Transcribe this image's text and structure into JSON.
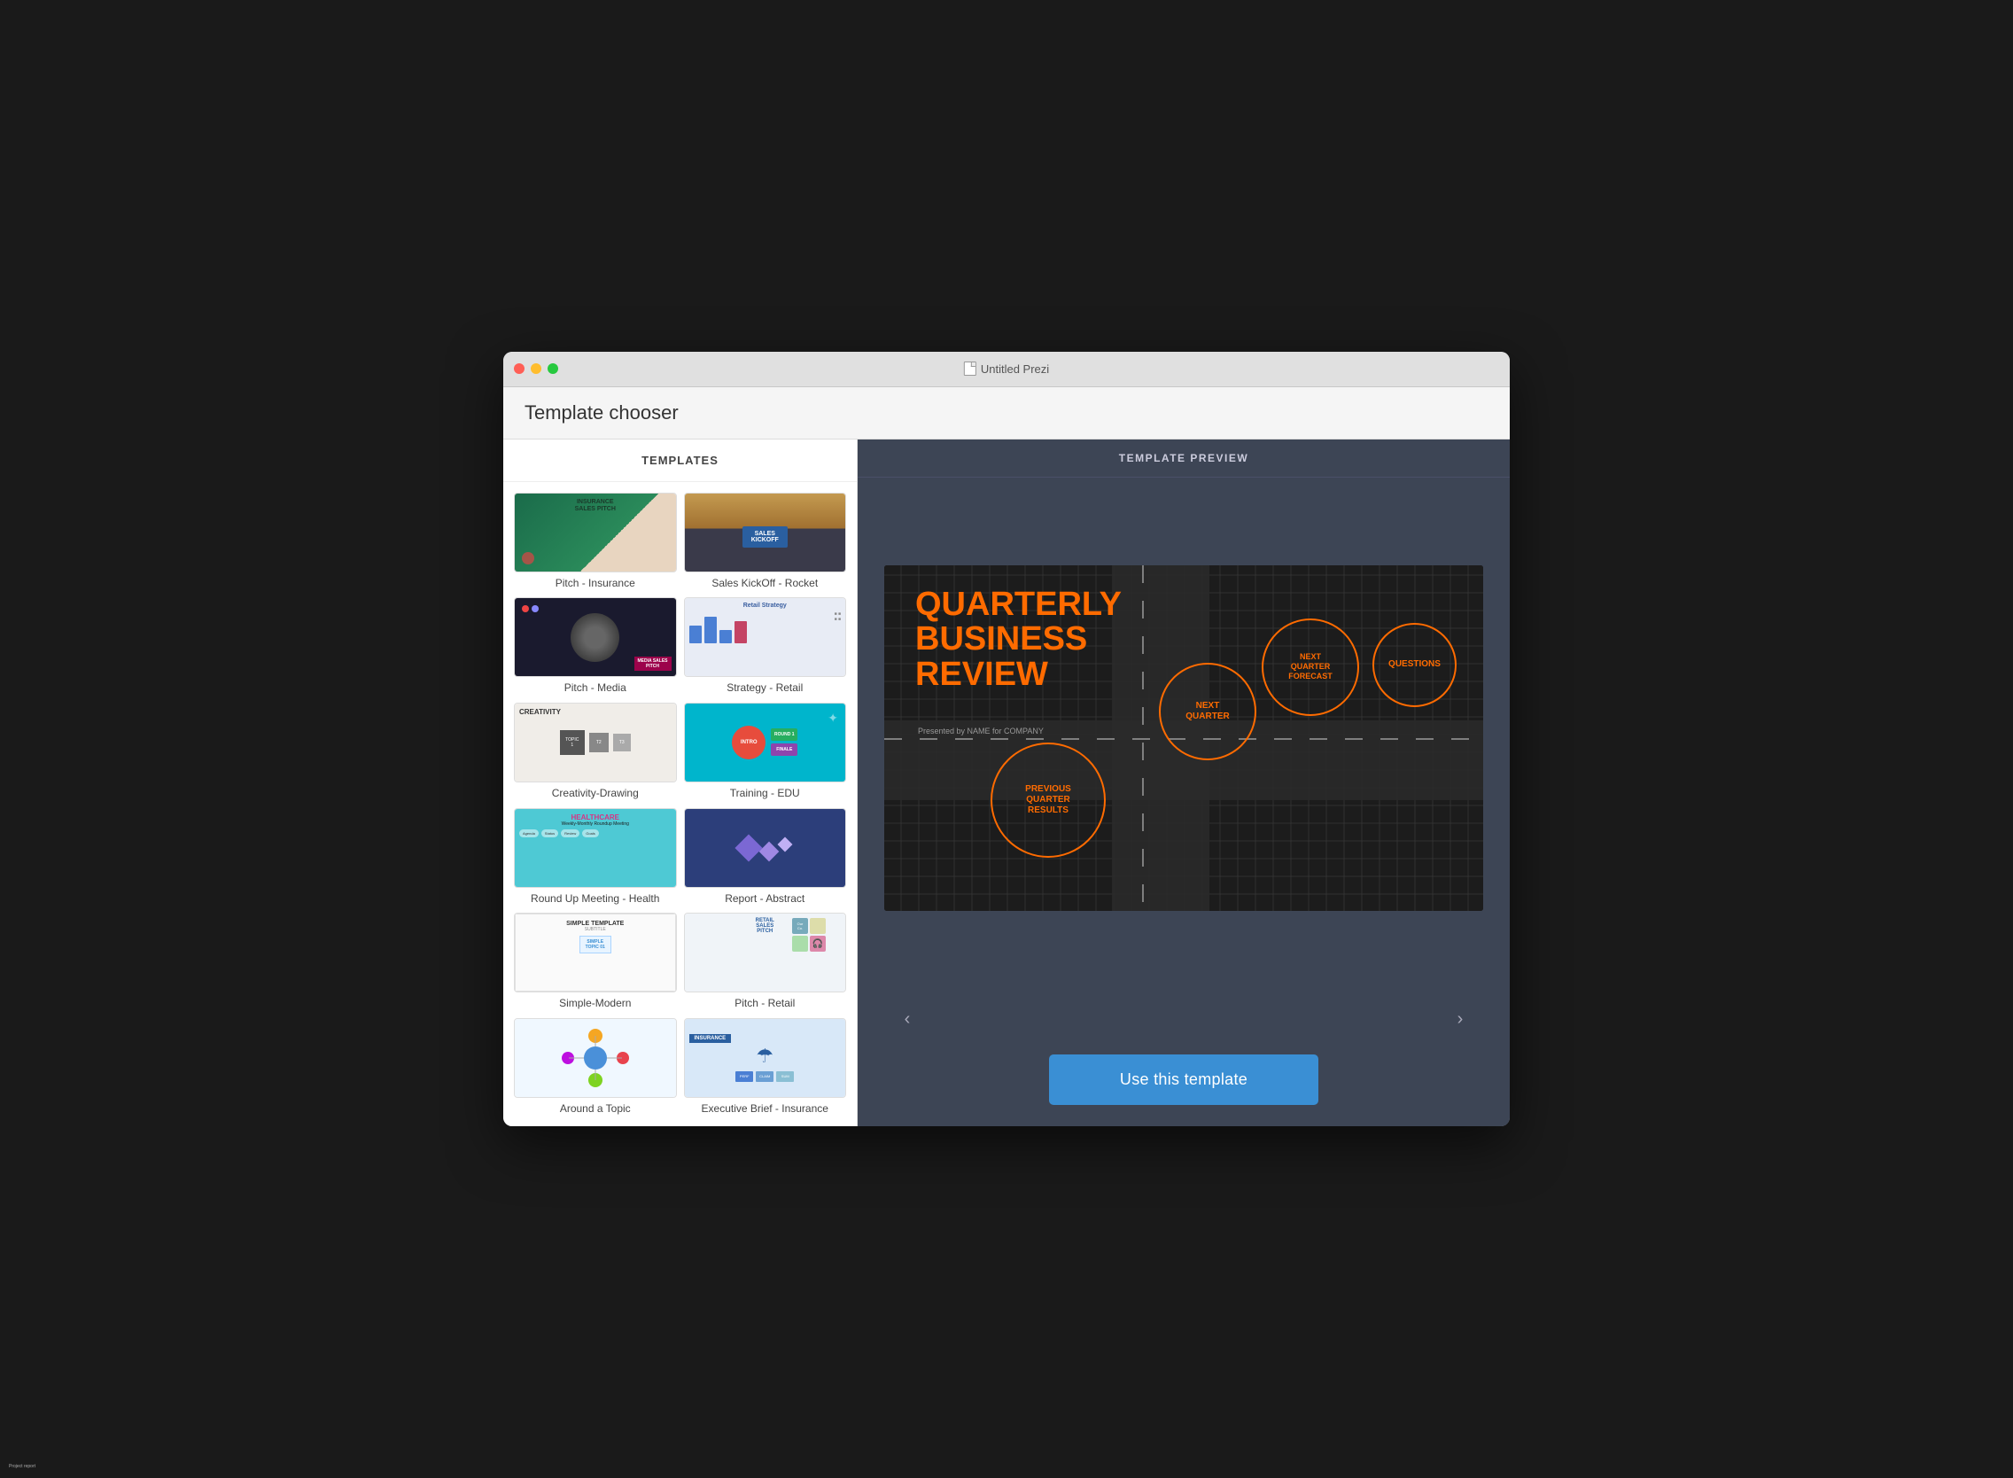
{
  "window": {
    "title": "Untitled Prezi"
  },
  "app": {
    "header_title": "Template chooser"
  },
  "templates_panel": {
    "header": "TEMPLATES"
  },
  "preview_panel": {
    "header": "TEMPLATE PREVIEW",
    "use_button_label": "Use this template"
  },
  "templates": [
    {
      "id": "pitch-insurance",
      "label": "Pitch - Insurance",
      "type": "thumb-insurance"
    },
    {
      "id": "sales-kickoff",
      "label": "Sales KickOff - Rocket",
      "type": "thumb-sales-kickoff"
    },
    {
      "id": "pitch-media",
      "label": "Pitch - Media",
      "type": "thumb-pitch-media"
    },
    {
      "id": "strategy-retail",
      "label": "Strategy - Retail",
      "type": "thumb-strategy-retail"
    },
    {
      "id": "creativity-drawing",
      "label": "Creativity-Drawing",
      "type": "thumb-creativity"
    },
    {
      "id": "training-edu",
      "label": "Training - EDU",
      "type": "thumb-training"
    },
    {
      "id": "roundup-health",
      "label": "Round Up Meeting - Health",
      "type": "thumb-healthcare"
    },
    {
      "id": "report-abstract",
      "label": "Report - Abstract",
      "type": "thumb-report"
    },
    {
      "id": "simple-modern",
      "label": "Simple-Modern",
      "type": "thumb-simple"
    },
    {
      "id": "pitch-retail",
      "label": "Pitch - Retail",
      "type": "thumb-pitch-retail"
    },
    {
      "id": "around-topic",
      "label": "Around a Topic",
      "type": "thumb-around"
    },
    {
      "id": "exec-brief",
      "label": "Executive Brief - Insurance",
      "type": "thumb-exec"
    }
  ],
  "preview": {
    "title_line1": "QUARTERLY",
    "title_line2": "BUSINESS",
    "title_line3": "REVIEW",
    "subtitle": "Presented by NAME for COMPANY",
    "circle1_label": "PREVIOUS\nQUARTER\nRESULTS",
    "circle2_label": "NEXT\nQUARTER",
    "circle3_label": "NEXT\nQUARTER\nFORECAST",
    "circle4_label": "QUESTIONS"
  },
  "nav": {
    "prev_arrow": "‹",
    "next_arrow": "›"
  }
}
